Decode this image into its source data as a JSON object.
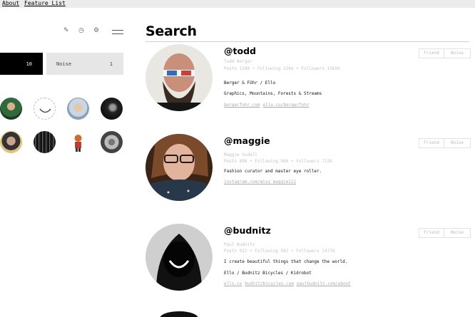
{
  "topnav": {
    "about": "About",
    "feature_list": "Feature List"
  },
  "sidebar": {
    "icons": [
      "pencil-icon",
      "clock-icon",
      "gear-icon",
      "menu-icon"
    ],
    "tabs": [
      {
        "label": "",
        "count": "10"
      },
      {
        "label": "Noise",
        "count": "1"
      }
    ]
  },
  "search": {
    "title": "Search"
  },
  "results": [
    {
      "username": "@todd",
      "real_name": "Todd Berger",
      "stats": "Posts 1288 • Following 1266 • Followers 15656",
      "bio": [
        "Berger & Föhr / Ello",
        "Graphics, Mountains, Forests & Streams"
      ],
      "links": [
        "bergerfohr.com",
        "ello.co/bergerfohr"
      ],
      "friend_label": "Friend",
      "noise_label": "Noise"
    },
    {
      "username": "@maggie",
      "real_name": "Maggie Godell",
      "stats": "Posts 898 • Following 966 • Followers 7138",
      "bio": [
        "Fashion curator and master eye roller."
      ],
      "links": [
        "instagram.com/miss_maggie111"
      ],
      "friend_label": "Friend",
      "noise_label": "Noise"
    },
    {
      "username": "@budnitz",
      "real_name": "Paul Budnitz",
      "stats": "Posts 912 • Following 502 • Followers 14776",
      "bio": [
        "I create beautiful things that change the world.",
        "Ello / Budnitz Bicycles / Kidrobot"
      ],
      "links": [
        "ello.co",
        "budnitzbicycles.com",
        "paulbudnitz.com/about"
      ],
      "friend_label": "Friend",
      "noise_label": "Noise"
    }
  ]
}
